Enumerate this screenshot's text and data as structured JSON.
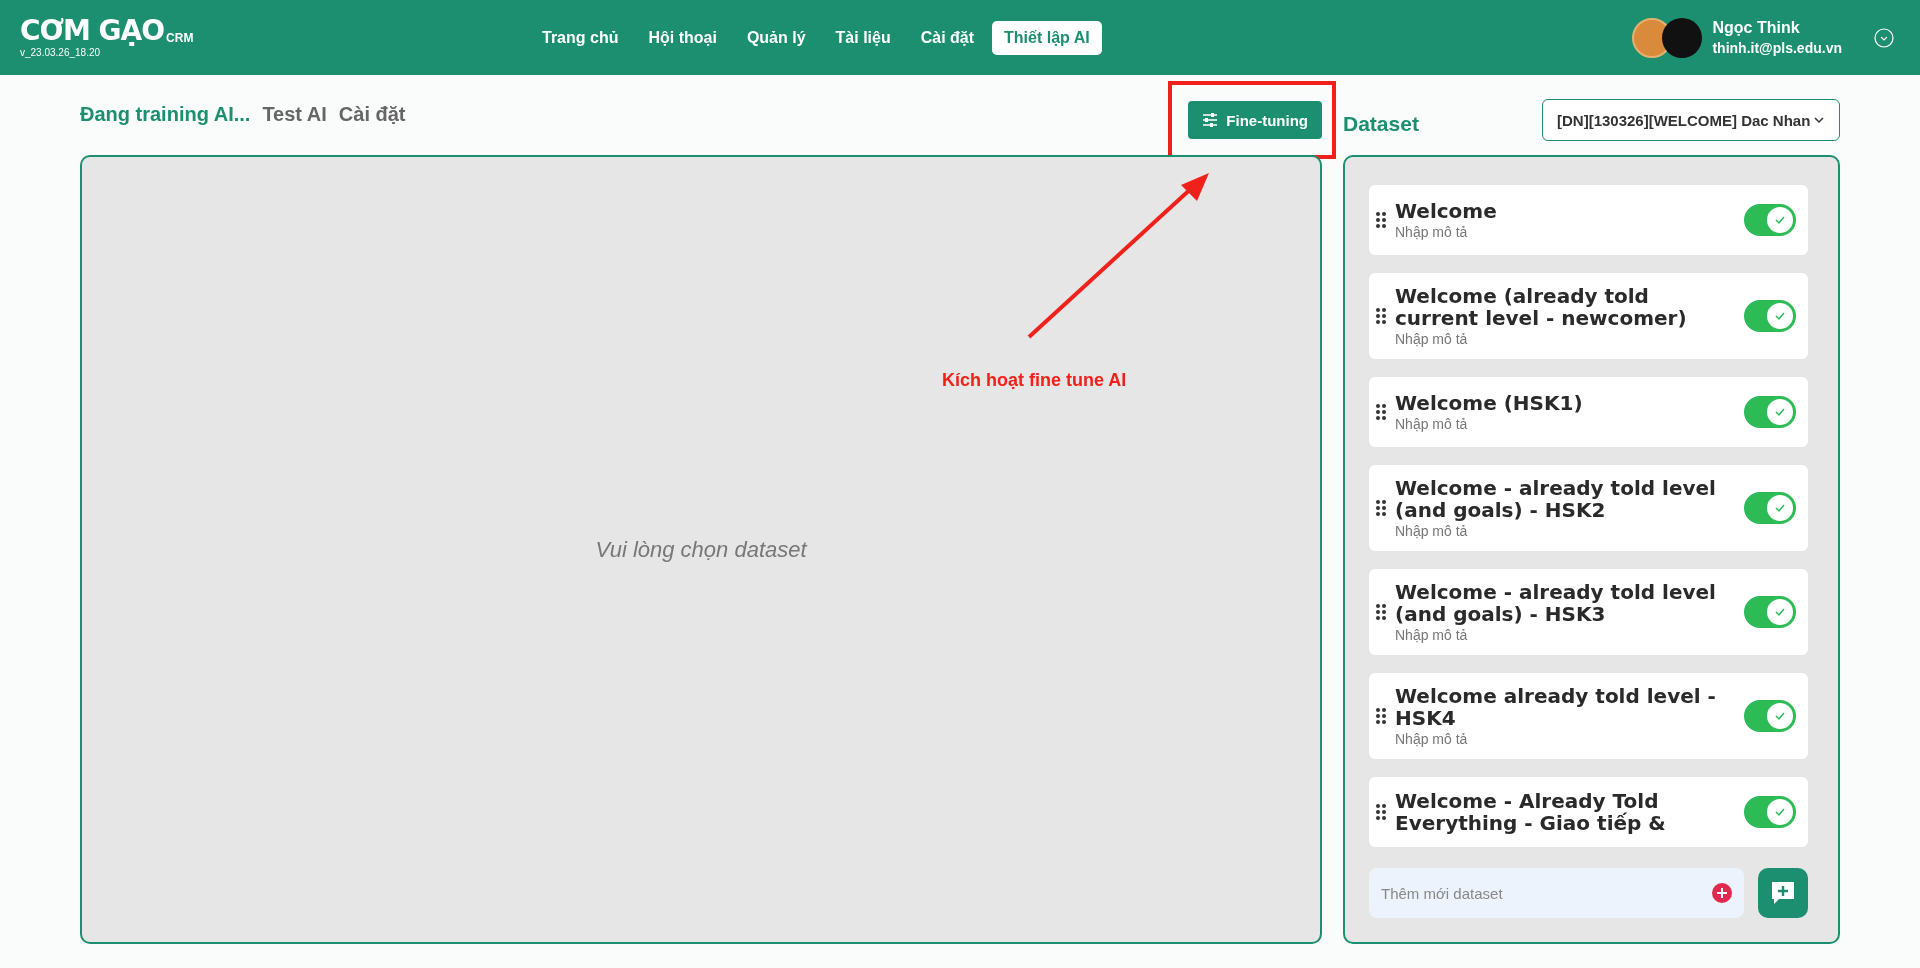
{
  "header": {
    "logo": {
      "name": "CƠM GẠO",
      "suffix": "CRM",
      "version": "v_23.03.26_18.20"
    },
    "nav": [
      {
        "label": "Trang chủ",
        "selected": false
      },
      {
        "label": "Hội thoại",
        "selected": false
      },
      {
        "label": "Quản lý",
        "selected": false
      },
      {
        "label": "Tài liệu",
        "selected": false
      },
      {
        "label": "Cài đặt",
        "selected": false
      },
      {
        "label": "Thiết lập AI",
        "selected": true
      }
    ],
    "user": {
      "name": "Ngọc Think",
      "email": "thinh.it@pls.edu.vn"
    }
  },
  "tabs": [
    {
      "label": "Đang training AI...",
      "selected": true
    },
    {
      "label": "Test AI",
      "selected": false
    },
    {
      "label": "Cài đặt",
      "selected": false
    }
  ],
  "fine_tuning_button": "Fine-tuning",
  "preview": {
    "empty_text": "Vui lòng chọn dataset"
  },
  "annotation": {
    "text": "Kích hoạt fine tune AI"
  },
  "dataset_panel": {
    "title": "Dataset",
    "selected_dataset": "[DN][130326][WELCOME] Dac Nhan",
    "items": [
      {
        "title": "Welcome",
        "description": "Nhập mô tả",
        "enabled": true
      },
      {
        "title": "Welcome (already told current level - newcomer)",
        "description": "Nhập mô tả",
        "enabled": true
      },
      {
        "title": "Welcome (HSK1)",
        "description": "Nhập mô tả",
        "enabled": true
      },
      {
        "title": "Welcome - already told level (and goals) - HSK2",
        "description": "Nhập mô tả",
        "enabled": true
      },
      {
        "title": "Welcome - already told level (and goals) - HSK3",
        "description": "Nhập mô tả",
        "enabled": true
      },
      {
        "title": "Welcome already told level - HSK4",
        "description": "Nhập mô tả",
        "enabled": true
      },
      {
        "title": "Welcome - Already Told Everything - Giao tiếp &",
        "enabled": true
      }
    ],
    "new_dataset": {
      "placeholder": "Thêm mới dataset"
    }
  }
}
